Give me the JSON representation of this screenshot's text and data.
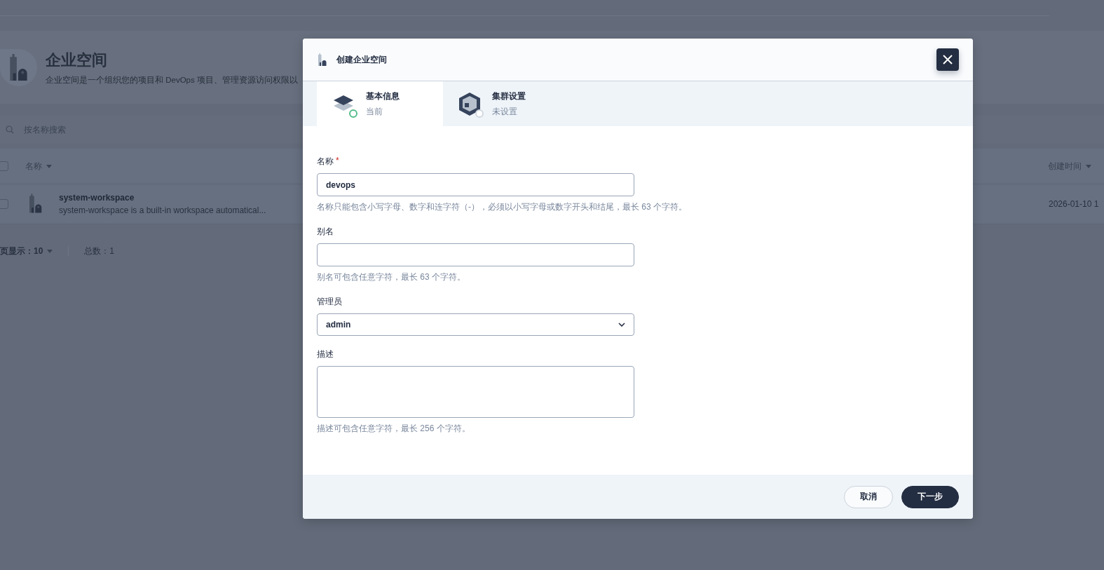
{
  "page": {
    "title": "企业空间",
    "description": "企业空间是一个组织您的项目和 DevOps 项目、管理资源访问权限以",
    "search": {
      "placeholder": "按名称搜索"
    },
    "table": {
      "select_all": {
        "checked": false
      },
      "columns": [
        {
          "label": "名称"
        },
        {
          "label": "创建时间"
        }
      ],
      "rows": [
        {
          "name": "system-workspace",
          "description": "system-workspace is a built-in workspace automatical...",
          "created": "2026-01-10 1",
          "checked": false
        }
      ]
    },
    "pagination": {
      "page_size_label": "页显示：",
      "page_size": "10",
      "total": "总数：1"
    }
  },
  "modal": {
    "title": "创建企业空间",
    "steps": [
      {
        "title": "基本信息",
        "status": "当前",
        "selected": true,
        "kind": "layers"
      },
      {
        "title": "集群设置",
        "status": "未设置",
        "selected": false,
        "kind": "cube"
      }
    ],
    "fields": [
      {
        "kind": "text",
        "label": "名称",
        "required_mark": "*",
        "value": "devops",
        "hint": "名称只能包含小写字母、数字和连字符（-），必须以小写字母或数字开头和结尾，最长 63 个字符。"
      },
      {
        "kind": "text",
        "label": "别名",
        "hint": "别名可包含任意字符，最长 63 个字符。"
      },
      {
        "kind": "select",
        "label": "管理员",
        "value": "admin"
      },
      {
        "kind": "textarea",
        "label": "描述",
        "hint": "描述可包含任意字符，最长 256 个字符。"
      }
    ],
    "buttons": [
      {
        "label": "取消",
        "kind": "secondary"
      },
      {
        "label": "下一步",
        "kind": "primary"
      }
    ]
  }
}
